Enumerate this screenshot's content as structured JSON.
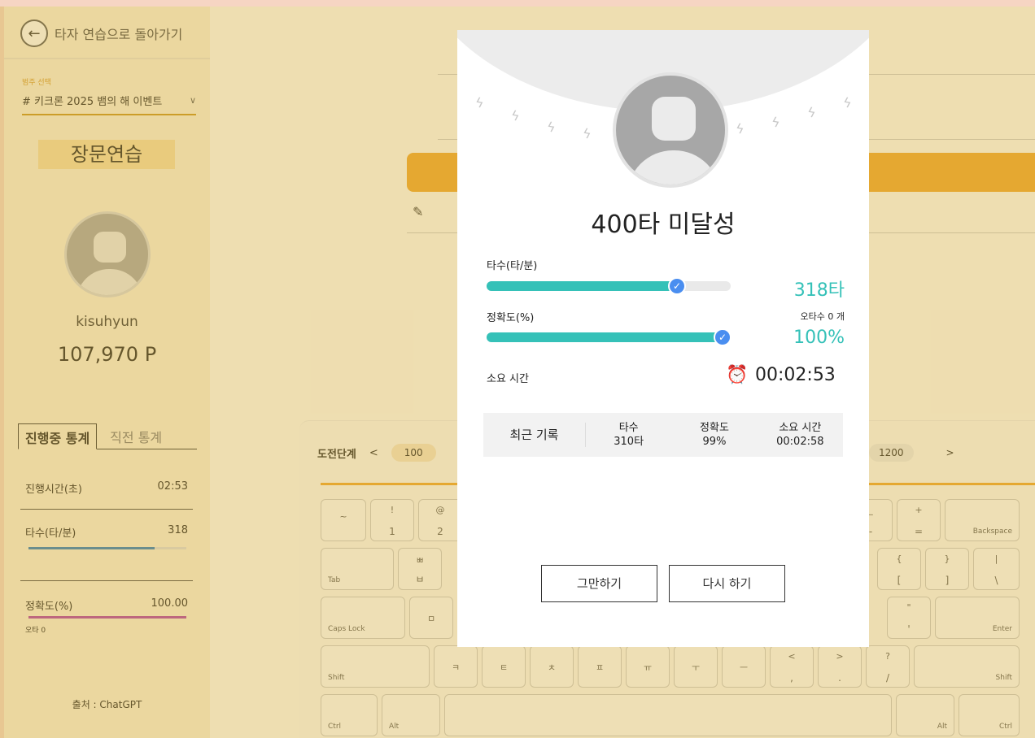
{
  "sidebar": {
    "back_label": "타자 연습으로 돌아가기",
    "category_label": "범주 선택",
    "category_value": "# 키크론 2025 뱀의 해 이벤트",
    "mode_title": "장문연습",
    "username": "kisuhyun",
    "points": "107,970 P",
    "tabs": [
      "진행중 통계",
      "직전 통계"
    ],
    "stats": {
      "time_label": "진행시간(초)",
      "time_value": "02:53",
      "speed_label": "타수(타/분)",
      "speed_value": "318",
      "speed_fill": 0.8,
      "acc_label": "정확도(%)",
      "acc_value": "100.00",
      "acc_fill": 1.0,
      "typo_label": "오타 0"
    },
    "source": "출처 : ChatGPT"
  },
  "keyboard": {
    "level_label": "도전단계",
    "prev_arrow": "<",
    "first_level": "100",
    "last_level": "1200",
    "next_arrow": ">",
    "keys": {
      "tilde": "~",
      "k1_top": "!",
      "k1": "1",
      "k2_top": "@",
      "k2": "2",
      "minus_top": "_",
      "minus": "-",
      "plus_top": "+",
      "equal": "=",
      "backspace": "Backspace",
      "tab": "Tab",
      "bb_top": "ㅃ",
      "bb": "ㅂ",
      "lbrace": "{",
      "lbracket": "[",
      "rbrace": "}",
      "rbracket": "]",
      "pipe": "|",
      "backslash": "\\",
      "capslock": "Caps Lock",
      "mieum": "ㅁ",
      "dquote": "\"",
      "squote": "'",
      "enter": "Enter",
      "shift": "Shift",
      "kieuk": "ㅋ",
      "tieut": "ㅌ",
      "chieuch": "ㅊ",
      "yu": "ㅍ",
      "yu2": "ㅠ",
      "u": "ㅜ",
      "eu": "ㅡ",
      "lt": "<",
      "comma": ",",
      "gt": ">",
      "period": ".",
      "question": "?",
      "slash": "/",
      "shift_r": "Shift",
      "ctrl": "Ctrl",
      "alt": "Alt",
      "alt_r": "Alt",
      "ctrl_r": "Ctrl"
    }
  },
  "modal": {
    "title": "400타 미달성",
    "speed_label": "타수(타/분)",
    "speed_value": "318타",
    "speed_fill": 0.78,
    "accuracy_label": "정확도(%)",
    "typo_count": "오타수 0 개",
    "accuracy_value": "100%",
    "accuracy_fill": 1.0,
    "time_label": "소요 시간",
    "time_icon": "alarm-clock-icon",
    "time_value": "00:02:53",
    "recent": {
      "label": "최근 기록",
      "speed_header": "타수",
      "speed": "310타",
      "acc_header": "정확도",
      "acc": "99%",
      "time_header": "소요 시간",
      "time": "00:02:58"
    },
    "stop_button": "그만하기",
    "retry_button": "다시 하기"
  },
  "colors": {
    "accent": "#f0a72a",
    "teal": "#35c1b8",
    "check_blue": "#4a8ef0",
    "speed_bar": "#2a7bbf",
    "acc_bar": "#b13ea7"
  }
}
